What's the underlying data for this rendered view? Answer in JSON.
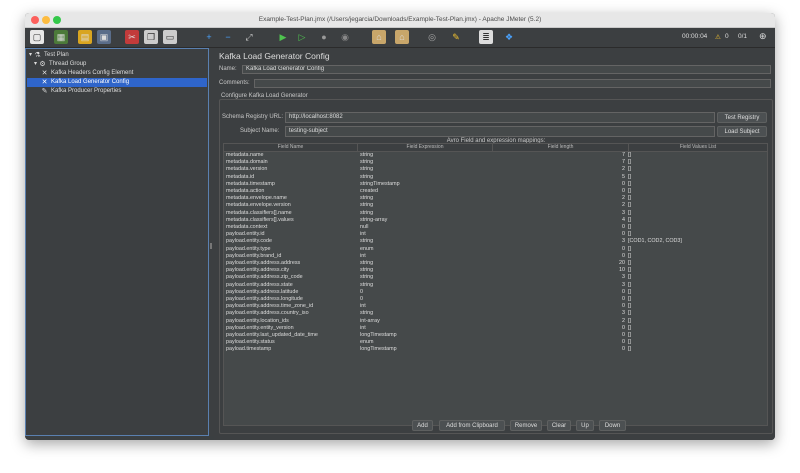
{
  "window": {
    "title": "Example-Test-Plan.jmx (/Users/jegarcia/Downloads/Example-Test-Plan.jmx) - Apache JMeter (5.2)"
  },
  "toolbar": {
    "timer": "00:00:04",
    "warnings": "0",
    "threads": "0/1"
  },
  "tree": {
    "items": [
      {
        "label": "Test Plan",
        "icon": "flask-icon"
      },
      {
        "label": "Thread Group",
        "icon": "gear-icon"
      },
      {
        "label": "Kafka Headers Config Element",
        "icon": "wrench-icon"
      },
      {
        "label": "Kafka Load Generator Config",
        "icon": "wrench-icon"
      },
      {
        "label": "Kafka Producer Properties",
        "icon": "pencil-icon"
      }
    ]
  },
  "panel": {
    "title": "Kafka Load Generator Config",
    "name_label": "Name:",
    "name_value": "Kafka Load Generator Config",
    "comments_label": "Comments:",
    "comments_value": "",
    "section_title": "Configure Kafka Load Generator",
    "schema_label": "Schema Registry URL:",
    "schema_value": "http://localhost:8082",
    "test_registry_button": "Test Registry",
    "subject_label": "Subject Name:",
    "subject_value": "testing-subject",
    "load_subject_button": "Load Subject",
    "mappings_title": "Avro Field and expression mappings:"
  },
  "table": {
    "headers": [
      "Field Name",
      "Field Expression",
      "Field length",
      "Field Values List"
    ],
    "rows": [
      [
        "metadata.name",
        "string",
        "7",
        "[]"
      ],
      [
        "metadata.domain",
        "string",
        "7",
        "[]"
      ],
      [
        "metadata.version",
        "string",
        "2",
        "[]"
      ],
      [
        "metadata.id",
        "string",
        "5",
        "[]"
      ],
      [
        "metadata.timestamp",
        "stringTimestamp",
        "0",
        "[]"
      ],
      [
        "metadata.action",
        "created",
        "0",
        "[]"
      ],
      [
        "metadata.envelope.name",
        "string",
        "2",
        "[]"
      ],
      [
        "metadata.envelope.version",
        "string",
        "2",
        "[]"
      ],
      [
        "metadata.classifiers[].name",
        "string",
        "3",
        "[]"
      ],
      [
        "metadata.classifiers[].values",
        "string-array",
        "4",
        "[]"
      ],
      [
        "metadata.context",
        "null",
        "0",
        "[]"
      ],
      [
        "payload.entity.id",
        "int",
        "0",
        "[]"
      ],
      [
        "payload.entity.code",
        "string",
        "3",
        "[COD1, COD2, COD3]"
      ],
      [
        "payload.entity.type",
        "enum",
        "0",
        "[]"
      ],
      [
        "payload.entity.brand_id",
        "int",
        "0",
        "[]"
      ],
      [
        "payload.entity.address.address",
        "string",
        "20",
        "[]"
      ],
      [
        "payload.entity.address.city",
        "string",
        "10",
        "[]"
      ],
      [
        "payload.entity.address.zip_code",
        "string",
        "3",
        "[]"
      ],
      [
        "payload.entity.address.state",
        "string",
        "3",
        "[]"
      ],
      [
        "payload.entity.address.latitude",
        "0",
        "0",
        "[]"
      ],
      [
        "payload.entity.address.longitude",
        "0",
        "0",
        "[]"
      ],
      [
        "payload.entity.address.time_zone_id",
        "int",
        "0",
        "[]"
      ],
      [
        "payload.entity.address.country_iso",
        "string",
        "3",
        "[]"
      ],
      [
        "payload.entity.location_ids",
        "int-array",
        "2",
        "[]"
      ],
      [
        "payload.entity.entity_version",
        "int",
        "0",
        "[]"
      ],
      [
        "payload.entity.last_updated_date_time",
        "longTimestamp",
        "0",
        "[]"
      ],
      [
        "payload.entity.status",
        "enum",
        "0",
        "[]"
      ],
      [
        "payload.timestamp",
        "longTimestamp",
        "0",
        "[]"
      ]
    ]
  },
  "buttons": {
    "add": "Add",
    "add_clipboard": "Add from Clipboard",
    "remove": "Remove",
    "clear": "Clear",
    "up": "Up",
    "down": "Down"
  },
  "colors": {
    "selection": "#2f65ca",
    "background": "#3c3f41",
    "field": "#45494a"
  }
}
